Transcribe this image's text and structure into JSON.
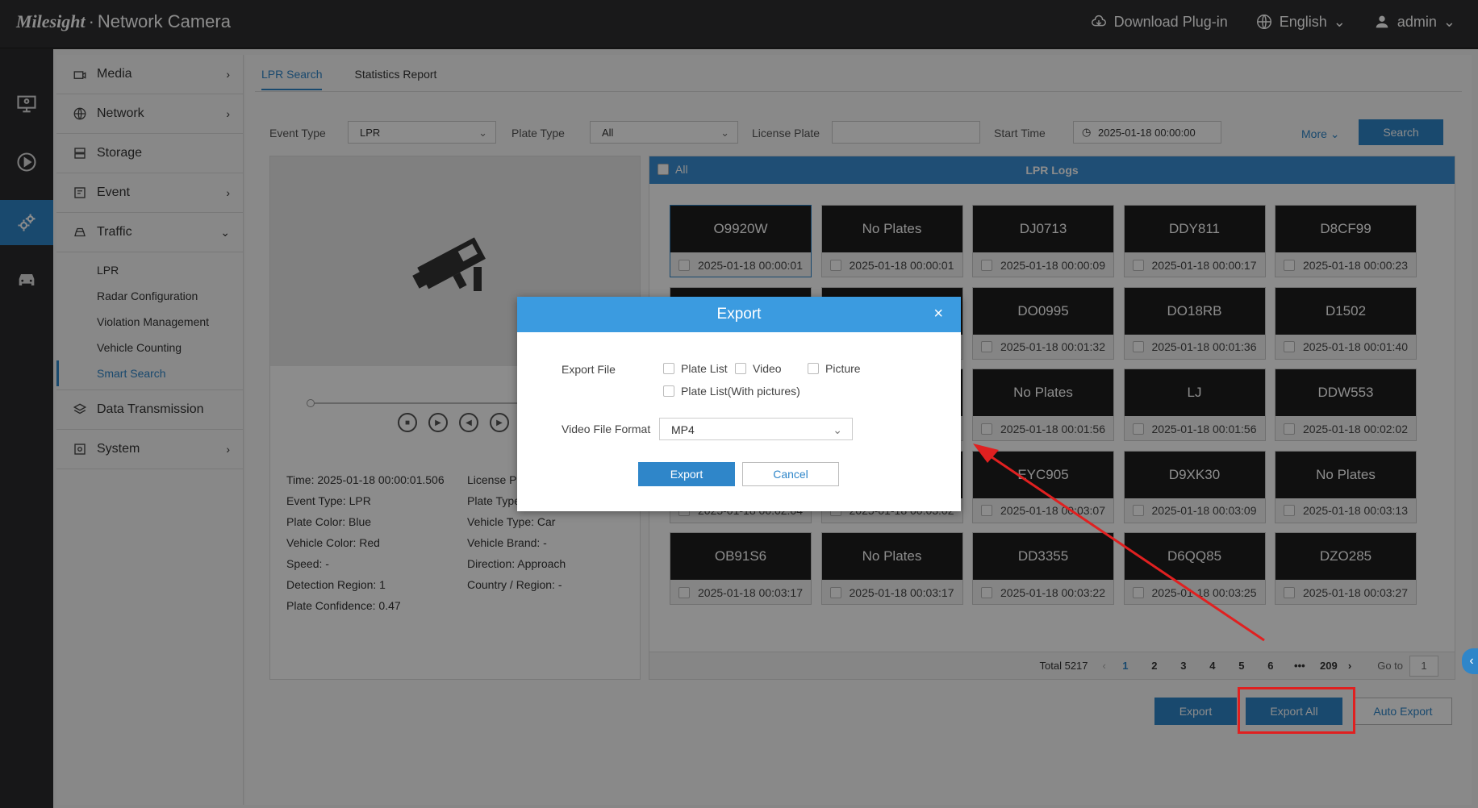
{
  "topbar": {
    "brand_logo": "Milesight",
    "brand_product": "Network Camera",
    "download_label": "Download Plug-in",
    "language_label": "English",
    "user_label": "admin"
  },
  "sidemenu": {
    "media": "Media",
    "network": "Network",
    "storage": "Storage",
    "event": "Event",
    "traffic": "Traffic",
    "sub": [
      "LPR",
      "Radar Configuration",
      "Violation Management",
      "Vehicle Counting",
      "Smart Search"
    ],
    "data_transmission": "Data Transmission",
    "system": "System"
  },
  "tabs": {
    "lpr_search": "LPR Search",
    "statistics_report": "Statistics Report"
  },
  "filters": {
    "event_type_label": "Event Type",
    "event_type_value": "LPR",
    "plate_type_label": "Plate Type",
    "plate_type_value": "All",
    "license_plate_label": "License Plate",
    "license_plate_value": "",
    "start_time_label": "Start Time",
    "start_time_value": "2025-01-18 00:00:00",
    "more_label": "More",
    "search_label": "Search"
  },
  "player_info": {
    "time": "Time: 2025-01-18 00:00:01.506",
    "event_type": "Event Type: LPR",
    "plate_color": "Plate Color: Blue",
    "vehicle_color": "Vehicle Color: Red",
    "speed": "Speed: -",
    "detection_region": "Detection Region: 1",
    "plate_confidence": "Plate Confidence: 0.47",
    "license_plate": "License P",
    "plate_type": "Plate Type",
    "vehicle_type": "Vehicle Type: Car",
    "vehicle_brand": "Vehicle Brand: -",
    "direction": "Direction: Approach",
    "country_region": "Country / Region: -"
  },
  "logs": {
    "all_label": "All",
    "title": "LPR Logs",
    "cards": [
      {
        "plate": "O9920W",
        "time": "2025-01-18 00:00:01"
      },
      {
        "plate": "No Plates",
        "time": "2025-01-18 00:00:01"
      },
      {
        "plate": "DJ0713",
        "time": "2025-01-18 00:00:09"
      },
      {
        "plate": "DDY811",
        "time": "2025-01-18 00:00:17"
      },
      {
        "plate": "D8CF99",
        "time": "2025-01-18 00:00:23"
      },
      {
        "plate": "",
        "time": ""
      },
      {
        "plate": "",
        "time": ""
      },
      {
        "plate": "DO0995",
        "time": "2025-01-18 00:01:32"
      },
      {
        "plate": "DO18RB",
        "time": "2025-01-18 00:01:36"
      },
      {
        "plate": "D1502",
        "time": "2025-01-18 00:01:40"
      },
      {
        "plate": "",
        "time": ""
      },
      {
        "plate": "",
        "time": ""
      },
      {
        "plate": "No Plates",
        "time": "2025-01-18 00:01:56"
      },
      {
        "plate": "LJ",
        "time": "2025-01-18 00:01:56"
      },
      {
        "plate": "DDW553",
        "time": "2025-01-18 00:02:02"
      },
      {
        "plate": "",
        "time": "2025-01-18 00:02:04"
      },
      {
        "plate": "",
        "time": "2025-01-18 00:03:02"
      },
      {
        "plate": "EYC905",
        "time": "2025-01-18 00:03:07"
      },
      {
        "plate": "D9XK30",
        "time": "2025-01-18 00:03:09"
      },
      {
        "plate": "No Plates",
        "time": "2025-01-18 00:03:13"
      },
      {
        "plate": "OB91S6",
        "time": "2025-01-18 00:03:17"
      },
      {
        "plate": "No Plates",
        "time": "2025-01-18 00:03:17"
      },
      {
        "plate": "DD3355",
        "time": "2025-01-18 00:03:22"
      },
      {
        "plate": "D6QQ85",
        "time": "2025-01-18 00:03:25"
      },
      {
        "plate": "DZO285",
        "time": "2025-01-18 00:03:27"
      }
    ]
  },
  "pager": {
    "total": "Total 5217",
    "pages": [
      "1",
      "2",
      "3",
      "4",
      "5",
      "6",
      "•••",
      "209"
    ],
    "goto_label": "Go to",
    "goto_value": "1"
  },
  "bottom": {
    "export": "Export",
    "export_all": "Export All",
    "auto_export": "Auto Export"
  },
  "modal": {
    "title": "Export",
    "export_file_label": "Export File",
    "opt_plate_list": "Plate List",
    "opt_video": "Video",
    "opt_picture": "Picture",
    "opt_plate_list_pictures": "Plate List(With pictures)",
    "video_format_label": "Video File Format",
    "video_format_value": "MP4",
    "export_btn": "Export",
    "cancel_btn": "Cancel"
  },
  "colors": {
    "accent": "#2f86c9",
    "modal_header": "#3b9be0",
    "annotation": "#e02020"
  }
}
